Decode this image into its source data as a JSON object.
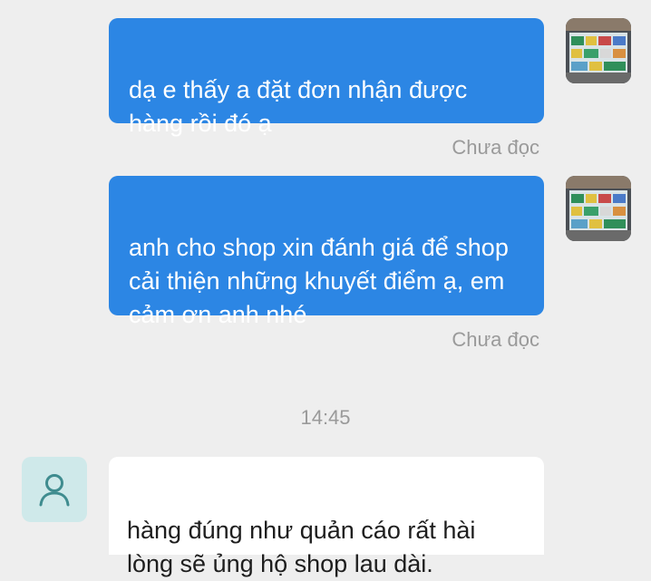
{
  "conversation": {
    "messages": [
      {
        "direction": "outgoing",
        "text": "dạ e thấy a đặt đơn nhận được\nhàng rồi đó ạ",
        "status": "Chưa đọc",
        "avatar": "shop-storefront-photo"
      },
      {
        "direction": "outgoing",
        "text": "anh cho shop xin đánh giá để shop\ncải thiện những khuyết điểm ạ, em\ncảm ơn anh nhé",
        "status": "Chưa đọc",
        "avatar": "shop-storefront-photo"
      }
    ],
    "time_separator": "14:45",
    "incoming": {
      "text": "hàng đúng như quản cáo rất hài\nlòng sẽ ủng hộ shop lau dài.",
      "avatar": "user-icon"
    }
  },
  "colors": {
    "background": "#eeeeee",
    "outgoing_bubble": "#2c86e4",
    "incoming_bubble": "#ffffff",
    "status_text": "#9a9a9a",
    "user_avatar_bg": "#cfe9ea",
    "user_icon": "#3f8c8f"
  }
}
